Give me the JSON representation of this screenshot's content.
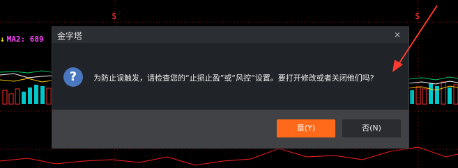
{
  "chart_background": {
    "markers": [
      "$",
      "$"
    ],
    "legend": {
      "arrow": "↓",
      "text": "MA2: 689"
    }
  },
  "dialog": {
    "title": "金字塔",
    "close_label": "×",
    "icon": "question-icon",
    "icon_glyph": "?",
    "message": "为防止误触发，请检查您的“止损止盈”或“风控”设置。要打开修改或者关闭他们吗?",
    "buttons": {
      "yes": "是(Y)",
      "no": "否(N)"
    }
  },
  "colors": {
    "accent": "#ff6a1a",
    "annotation_arrow": "#ff3b2f"
  }
}
